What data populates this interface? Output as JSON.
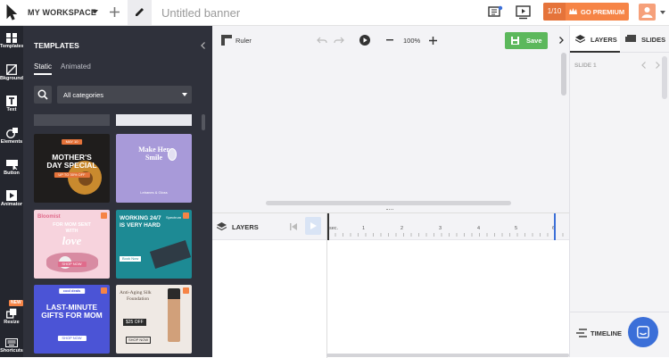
{
  "topbar": {
    "workspace_label": "MY WORKSPACE",
    "title_placeholder": "Untitled banner",
    "counter": "1/10",
    "premium_label": "GO PREMIUM"
  },
  "leftbar": {
    "items": [
      {
        "label": "Templates",
        "icon": "templates-icon"
      },
      {
        "label": "Bkground",
        "icon": "background-icon"
      },
      {
        "label": "Text",
        "icon": "text-icon"
      },
      {
        "label": "Elements",
        "icon": "elements-icon"
      },
      {
        "label": "Button",
        "icon": "button-icon"
      },
      {
        "label": "Animator",
        "icon": "animator-icon"
      },
      {
        "label": "Resize",
        "icon": "resize-icon",
        "badge": "NEW"
      },
      {
        "label": "Shortcuts",
        "icon": "keyboard-icon"
      }
    ]
  },
  "templates_panel": {
    "title": "TEMPLATES",
    "tabs": [
      "Static",
      "Animated"
    ],
    "category_select": "All categories",
    "cards": [
      {
        "lines": [
          "MAY 10",
          "MOTHER'S",
          "DAY SPECIAL",
          "UP TO 30% OFF"
        ],
        "bg": "#1f1d1c"
      },
      {
        "lines": [
          "Make Her",
          "Smile",
          "Lebanes & Gloss"
        ],
        "bg": "#a89ad9"
      },
      {
        "lines": [
          "Bloomist",
          "FOR MOM SENT",
          "WITH",
          "love",
          "SHOP NOW"
        ],
        "bg": "#f7d3dd"
      },
      {
        "lines": [
          "WORKING 24/7",
          "IS VERY HARD",
          "Spectrum",
          "Book Now"
        ],
        "bg": "#1d8a94"
      },
      {
        "lines": [
          "cool deals",
          "LAST-MINUTE",
          "GIFTS FOR MOM",
          "SHOP NOW"
        ],
        "bg": "#4b54d6"
      },
      {
        "lines": [
          "Anti-Aging Silk",
          "Foundation",
          "$25 OFF",
          "SHOP NOW"
        ],
        "bg": "#efe9e4"
      }
    ]
  },
  "editor": {
    "ruler_label": "Ruler",
    "zoom": "100%",
    "save_label": "Save"
  },
  "timeline": {
    "layers_label": "LAYERS",
    "sec_label": "sec.",
    "ticks": [
      "1",
      "2",
      "3",
      "4",
      "5",
      "6"
    ],
    "timeline_label": "TIMELINE"
  },
  "right_panel": {
    "tabs": [
      "LAYERS",
      "SLIDES"
    ],
    "slide_label": "SLIDE 1"
  },
  "colors": {
    "accent_orange": "#f68446",
    "save_green": "#5cb85c",
    "dark_panel": "#2f313b",
    "chat_blue": "#3b6fd8"
  }
}
